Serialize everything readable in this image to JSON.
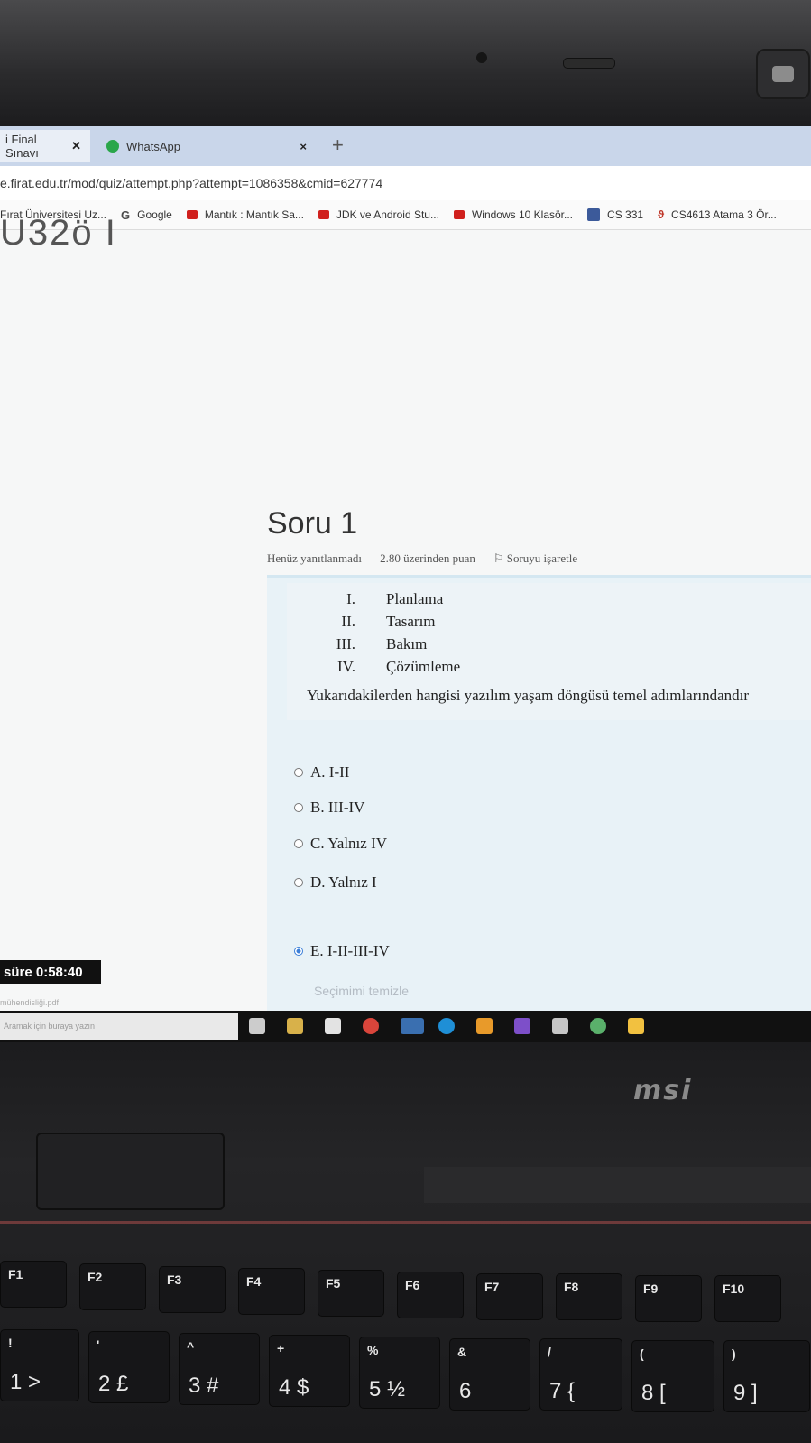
{
  "browser": {
    "tabs": [
      {
        "label": "i Final Sınavı",
        "close": "✕"
      },
      {
        "label": "WhatsApp",
        "close": "×"
      }
    ],
    "new_tab": "+",
    "url": "e.firat.edu.tr/mod/quiz/attempt.php?attempt=1086358&cmid=627774",
    "bookmarks": [
      {
        "label": "Fırat Üniversitesi Uz...",
        "icon": "none"
      },
      {
        "label": "Google",
        "icon": "google-icon"
      },
      {
        "label": "Mantık : Mantık Sa...",
        "icon": "youtube-icon"
      },
      {
        "label": "JDK ve Android Stu...",
        "icon": "youtube-icon"
      },
      {
        "label": "Windows 10 Klasör...",
        "icon": "youtube-icon"
      },
      {
        "label": "CS 331",
        "icon": "cs-icon"
      },
      {
        "label": "CS4613 Atama 3 Ör...",
        "icon": "d2l-icon"
      }
    ]
  },
  "page": {
    "course_code": "U32ö I",
    "question": {
      "title": "Soru 1",
      "status": "Henüz yanıtlanmadı",
      "points": "2.80 üzerinden puan",
      "flag": "Soruyu işaretle",
      "items": [
        {
          "num": "I.",
          "text": "Planlama"
        },
        {
          "num": "II.",
          "text": "Tasarım"
        },
        {
          "num": "III.",
          "text": "Bakım"
        },
        {
          "num": "IV.",
          "text": "Çözümleme"
        }
      ],
      "prompt": "Yukarıdakilerden hangisi yazılım yaşam döngüsü temel adımlarındandır",
      "options": [
        {
          "label": "A. I-II",
          "selected": false
        },
        {
          "label": "B. III-IV",
          "selected": false
        },
        {
          "label": "C. Yalnız IV",
          "selected": false
        },
        {
          "label": "D. Yalnız I",
          "selected": false
        },
        {
          "label": "E. I-II-III-IV",
          "selected": true
        }
      ],
      "clear_choice": "Seçimimi temizle"
    },
    "timer": "süre 0:58:40",
    "download_file": "mühendisliği.pdf"
  },
  "taskbar": {
    "search_placeholder": "Aramak için buraya yazın"
  },
  "laptop": {
    "brand": "msi",
    "fn_keys": [
      "F1",
      "F2",
      "F3",
      "F4",
      "F5",
      "F6",
      "F7",
      "F8",
      "F9",
      "F10"
    ],
    "num_keys": [
      {
        "top": "!",
        "bottom": "1 >"
      },
      {
        "top": "'",
        "bottom": "2 £"
      },
      {
        "top": "^",
        "bottom": "3 #"
      },
      {
        "top": "+",
        "bottom": "4 $"
      },
      {
        "top": "%",
        "bottom": "5 ½"
      },
      {
        "top": "&",
        "bottom": "6"
      },
      {
        "top": "/",
        "bottom": "7 {"
      },
      {
        "top": "(",
        "bottom": "8 ["
      },
      {
        "top": ")",
        "bottom": "9 ]"
      }
    ]
  }
}
